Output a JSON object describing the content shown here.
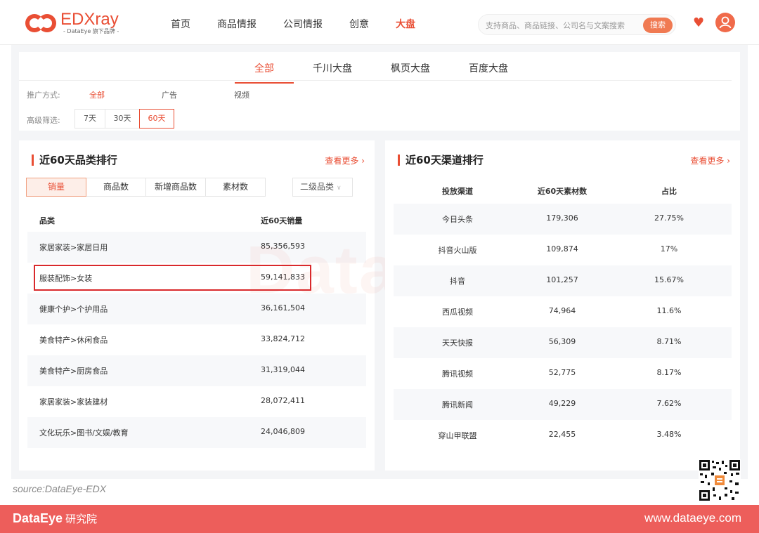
{
  "header": {
    "logo_name": "EDXray",
    "logo_sub": "- DataEye 旗下品牌 -",
    "nav": [
      "首页",
      "商品情报",
      "公司情报",
      "创意",
      "大盘"
    ],
    "nav_active": "大盘",
    "search_placeholder": "支持商品、商品链接、公司名与文案搜索",
    "search_button": "搜索",
    "favorite_icon": "heart-icon",
    "user_icon": "user-icon",
    "accent_color": "#e94e34"
  },
  "filters": {
    "tabs": [
      "全部",
      "千川大盘",
      "枫页大盘",
      "百度大盘"
    ],
    "tab_active": "全部",
    "promo_label": "推广方式:",
    "promo_options": [
      "全部",
      "广告",
      "视频"
    ],
    "promo_active": "全部",
    "advanced_label": "高级筛选:",
    "day_options": [
      "7天",
      "30天",
      "60天"
    ],
    "day_active": "60天"
  },
  "category_rank": {
    "title": "近60天品类排行",
    "more": "查看更多 ›",
    "segments": [
      "销量",
      "商品数",
      "新增商品数",
      "素材数"
    ],
    "segment_active": "销量",
    "dropdown": "二级品类",
    "columns": [
      "品类",
      "近60天销量"
    ],
    "rows": [
      {
        "category": "家居家装>家居日用",
        "value": "85,356,593"
      },
      {
        "category": "服装配饰>女装",
        "value": "59,141,833"
      },
      {
        "category": "健康个护>个护用品",
        "value": "36,161,504"
      },
      {
        "category": "美食特产>休闲食品",
        "value": "33,824,712"
      },
      {
        "category": "美食特产>厨房食品",
        "value": "31,319,044"
      },
      {
        "category": "家居家装>家装建材",
        "value": "28,072,411"
      },
      {
        "category": "文化玩乐>图书/文娱/教育",
        "value": "24,046,809"
      }
    ]
  },
  "channel_rank": {
    "title": "近60天渠道排行",
    "more": "查看更多 ›",
    "columns": [
      "投放渠道",
      "近60天素材数",
      "占比"
    ],
    "rows": [
      {
        "channel": "今日头条",
        "count": "179,306",
        "share": "27.75%"
      },
      {
        "channel": "抖音火山版",
        "count": "109,874",
        "share": "17%"
      },
      {
        "channel": "抖音",
        "count": "101,257",
        "share": "15.67%"
      },
      {
        "channel": "西瓜视频",
        "count": "74,964",
        "share": "11.6%"
      },
      {
        "channel": "天天快报",
        "count": "56,309",
        "share": "8.71%"
      },
      {
        "channel": "腾讯视频",
        "count": "52,775",
        "share": "8.17%"
      },
      {
        "channel": "腾讯新闻",
        "count": "49,229",
        "share": "7.62%"
      },
      {
        "channel": "穿山甲联盟",
        "count": "22,455",
        "share": "3.48%"
      }
    ]
  },
  "watermark": "DataEye",
  "source": "source:DataEye-EDX",
  "footer": {
    "brand": "DataEye",
    "brand_suffix": "研究院",
    "site": "www.dataeye.com",
    "color": "#ed5e5b"
  }
}
